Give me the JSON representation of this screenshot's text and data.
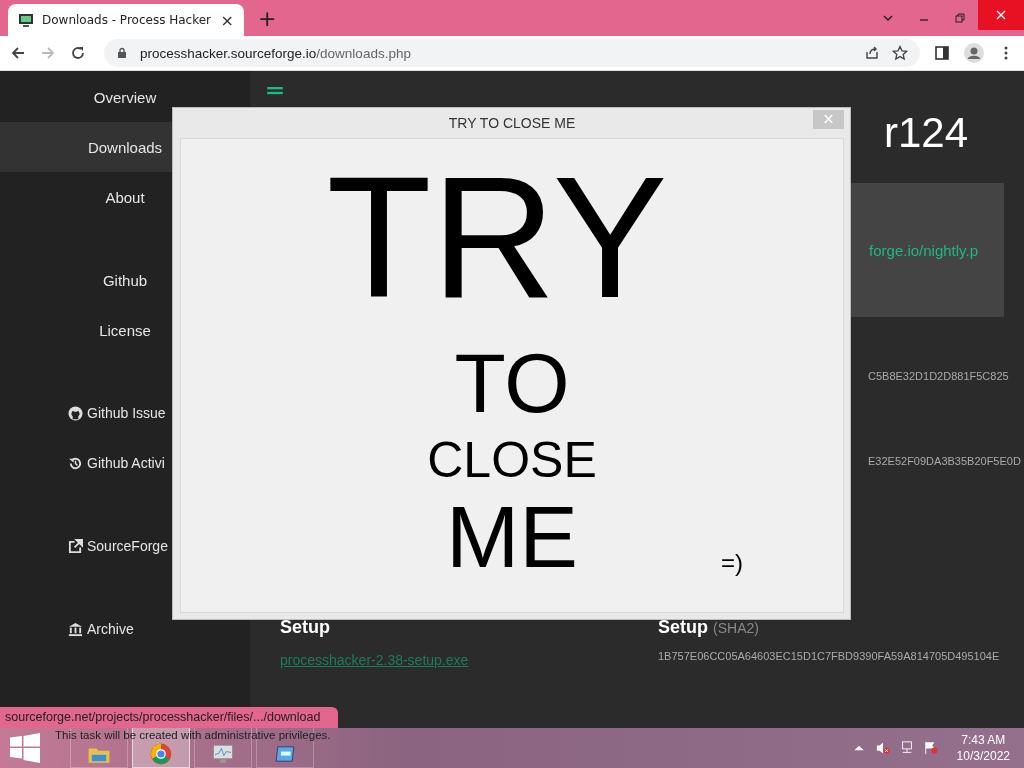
{
  "browser": {
    "tab": {
      "title": "Downloads - Process Hacker",
      "selected": true,
      "close": "×"
    },
    "new_tab": "+",
    "address": {
      "host": "processhacker.sourceforge.io",
      "path": "/downloads.php"
    }
  },
  "sidebar": {
    "groups": [
      [
        {
          "label": "Overview",
          "selected": false
        },
        {
          "label": "Downloads",
          "selected": true
        },
        {
          "label": "About",
          "selected": false
        }
      ],
      [
        {
          "label": "Github",
          "selected": false
        },
        {
          "label": "License",
          "selected": false
        }
      ],
      [
        {
          "label": "Github Issue",
          "selected": false,
          "kind": "github"
        },
        {
          "label": "Github Activi",
          "selected": false,
          "kind": "history"
        }
      ],
      [
        {
          "label": "SourceForge",
          "selected": false,
          "kind": "external"
        }
      ],
      [
        {
          "label": "Archive",
          "selected": false,
          "kind": "bank"
        }
      ]
    ]
  },
  "content": {
    "heading": "r124",
    "nightly_link": "forge.io/nightly.p",
    "hashes": [
      "C5B8E32D1D2D881F5C825",
      "E32E52F09DA3B35B20F5E0D"
    ],
    "downloads": [
      {
        "title": "Setup",
        "link": "processhacker-2.38-setup.exe"
      },
      {
        "title": "Setup",
        "note": "(SHA2)",
        "hash": "1B757E06CC05A64603EC15D1C7FBD9390FA59A814705D495104E"
      }
    ]
  },
  "dialog": {
    "title": "TRY TO CLOSE ME",
    "close": "×",
    "lines": [
      "TRY",
      "TO",
      "CLOSE",
      "ME"
    ],
    "smiley": "=)"
  },
  "status_url": "sourceforge.net/projects/processhacker/files/.../download",
  "taskbar": {
    "hint": "This task will be created with administrative privileges.",
    "apps": [
      {
        "kind": "folder",
        "selected": false
      },
      {
        "kind": "chrome",
        "selected": true
      },
      {
        "kind": "monitor",
        "selected": false
      },
      {
        "kind": "window",
        "selected": false
      }
    ],
    "time": "7:43 AM",
    "date": "10/3/2022"
  }
}
